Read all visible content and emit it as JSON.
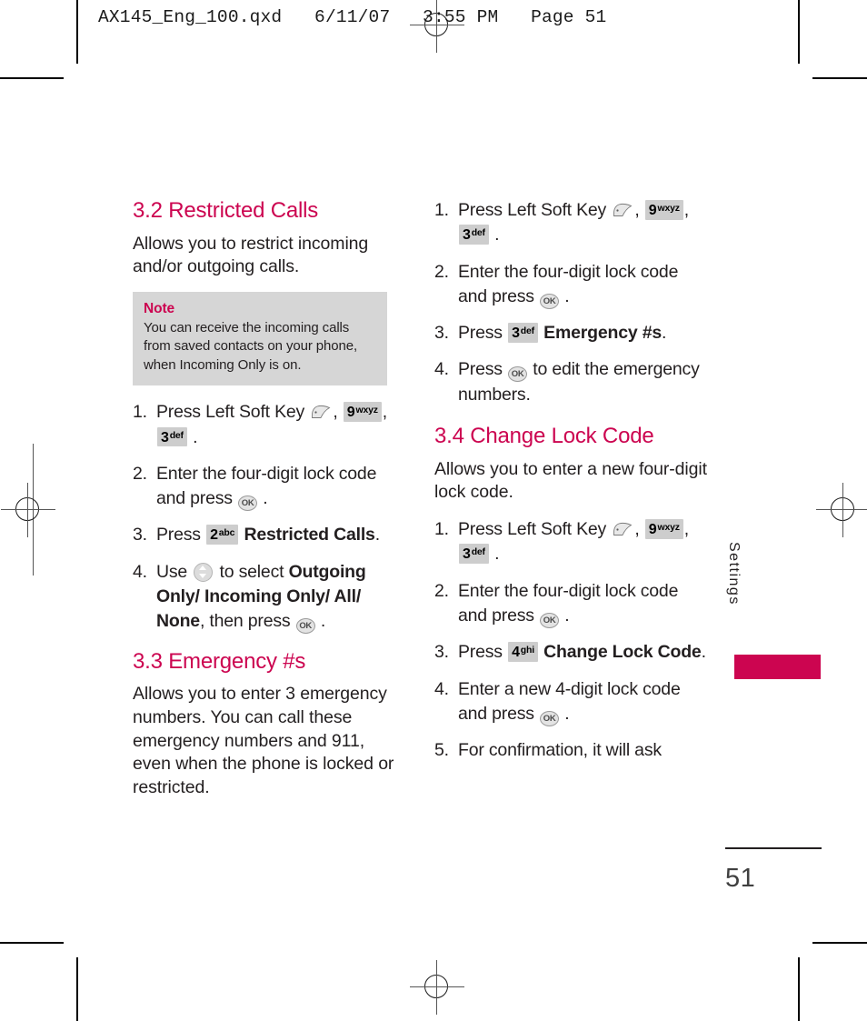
{
  "slug": {
    "text": "AX145_Eng_100.qxd   6/11/07   3:55 PM   Page 51"
  },
  "side_tab": {
    "label": "Settings",
    "color": "#cc0550"
  },
  "page_footer": {
    "number": "51"
  },
  "left_column": {
    "section": {
      "heading": "3.2 Restricted Calls",
      "intro": "Allows you to restrict incoming and/or outgoing calls."
    },
    "note": {
      "title": "Note",
      "body": "You can receive the incoming calls from saved contacts on your phone, when Incoming Only is on.",
      "background": "#d6d6d6"
    },
    "steps": [
      {
        "num": "1.",
        "parts": [
          {
            "t": "text",
            "v": "Press Left Soft Key "
          },
          {
            "t": "softkey"
          },
          {
            "t": "text",
            "v": ", "
          },
          {
            "t": "key",
            "digit": "9",
            "letters": "wxyz"
          },
          {
            "t": "text",
            "v": ", "
          },
          {
            "t": "key",
            "digit": "3",
            "letters": "def"
          },
          {
            "t": "text",
            "v": " ."
          }
        ]
      },
      {
        "num": "2.",
        "parts": [
          {
            "t": "text",
            "v": "Enter the four-digit lock code and press "
          },
          {
            "t": "ok",
            "v": "OK"
          },
          {
            "t": "text",
            "v": " ."
          }
        ]
      },
      {
        "num": "3.",
        "parts": [
          {
            "t": "text",
            "v": "Press "
          },
          {
            "t": "key",
            "digit": "2",
            "letters": "abc"
          },
          {
            "t": "text",
            "v": "  "
          },
          {
            "t": "bold",
            "v": "Restricted Calls"
          },
          {
            "t": "text",
            "v": "."
          }
        ]
      },
      {
        "num": "4.",
        "parts": [
          {
            "t": "text",
            "v": "Use "
          },
          {
            "t": "nav"
          },
          {
            "t": "text",
            "v": " to select "
          },
          {
            "t": "bold",
            "v": "Outgoing Only/ Incoming Only/ All/ None"
          },
          {
            "t": "text",
            "v": ", then press "
          },
          {
            "t": "ok",
            "v": "OK"
          },
          {
            "t": "text",
            "v": " ."
          }
        ]
      }
    ],
    "section2": {
      "heading": "3.3 Emergency #s",
      "intro": "Allows you to enter 3 emergency numbers. You can call these emergency numbers and 911, even when the phone is locked or restricted."
    }
  },
  "right_column": {
    "steps_emergency": [
      {
        "num": "1.",
        "parts": [
          {
            "t": "text",
            "v": "Press Left Soft Key "
          },
          {
            "t": "softkey"
          },
          {
            "t": "text",
            "v": ", "
          },
          {
            "t": "key",
            "digit": "9",
            "letters": "wxyz"
          },
          {
            "t": "text",
            "v": ", "
          },
          {
            "t": "key",
            "digit": "3",
            "letters": "def"
          },
          {
            "t": "text",
            "v": " ."
          }
        ]
      },
      {
        "num": "2.",
        "parts": [
          {
            "t": "text",
            "v": "Enter the four-digit lock code and press "
          },
          {
            "t": "ok",
            "v": "OK"
          },
          {
            "t": "text",
            "v": " ."
          }
        ]
      },
      {
        "num": "3.",
        "parts": [
          {
            "t": "text",
            "v": "Press "
          },
          {
            "t": "key",
            "digit": "3",
            "letters": "def"
          },
          {
            "t": "text",
            "v": "  "
          },
          {
            "t": "bold",
            "v": "Emergency #s"
          },
          {
            "t": "text",
            "v": "."
          }
        ]
      },
      {
        "num": "4.",
        "parts": [
          {
            "t": "text",
            "v": "Press "
          },
          {
            "t": "ok",
            "v": "OK"
          },
          {
            "t": "text",
            "v": "  to edit the emergency numbers."
          }
        ]
      }
    ],
    "section": {
      "heading": "3.4 Change Lock Code",
      "intro": "Allows you to enter a new four-digit lock code."
    },
    "steps_lockcode": [
      {
        "num": "1.",
        "parts": [
          {
            "t": "text",
            "v": "Press Left Soft Key "
          },
          {
            "t": "softkey"
          },
          {
            "t": "text",
            "v": ", "
          },
          {
            "t": "key",
            "digit": "9",
            "letters": "wxyz"
          },
          {
            "t": "text",
            "v": ", "
          },
          {
            "t": "key",
            "digit": "3",
            "letters": "def"
          },
          {
            "t": "text",
            "v": " ."
          }
        ]
      },
      {
        "num": "2.",
        "parts": [
          {
            "t": "text",
            "v": "Enter the four-digit lock code and press "
          },
          {
            "t": "ok",
            "v": "OK"
          },
          {
            "t": "text",
            "v": " ."
          }
        ]
      },
      {
        "num": "3.",
        "parts": [
          {
            "t": "text",
            "v": "Press "
          },
          {
            "t": "key",
            "digit": "4",
            "letters": "ghi"
          },
          {
            "t": "text",
            "v": "  "
          },
          {
            "t": "bold",
            "v": "Change Lock Code"
          },
          {
            "t": "text",
            "v": "."
          }
        ]
      },
      {
        "num": "4.",
        "parts": [
          {
            "t": "text",
            "v": "Enter a new 4-digit lock code and press "
          },
          {
            "t": "ok",
            "v": "OK"
          },
          {
            "t": "text",
            "v": " ."
          }
        ]
      },
      {
        "num": "5.",
        "parts": [
          {
            "t": "text",
            "v": "For confirmation, it will ask"
          }
        ]
      }
    ]
  }
}
